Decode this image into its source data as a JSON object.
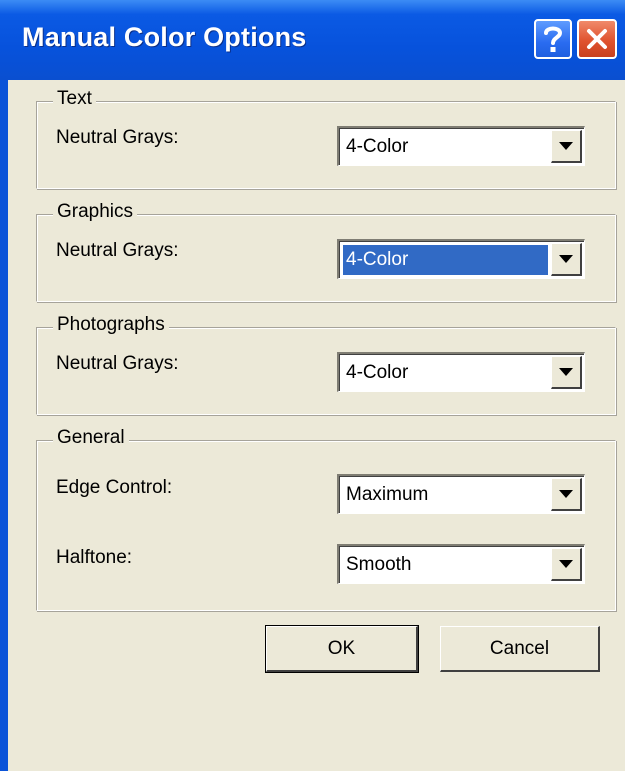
{
  "window": {
    "title": "Manual Color Options"
  },
  "groups": {
    "text": {
      "label": "Text",
      "field_label": "Neutral Grays:",
      "value": "4-Color"
    },
    "graphics": {
      "label": "Graphics",
      "field_label": "Neutral Grays:",
      "value": "4-Color"
    },
    "photographs": {
      "label": "Photographs",
      "field_label": "Neutral Grays:",
      "value": "4-Color"
    },
    "general": {
      "label": "General",
      "edge_label": "Edge Control:",
      "edge_value": "Maximum",
      "halftone_label": "Halftone:",
      "halftone_value": "Smooth"
    }
  },
  "buttons": {
    "ok": "OK",
    "cancel": "Cancel"
  },
  "icons": {
    "help": "help-icon",
    "close": "close-icon",
    "dropdown": "chevron-down-icon"
  },
  "colors": {
    "titlebar": "#0752dc",
    "selection": "#316ac5",
    "dialog_bg": "#ece9d8"
  }
}
